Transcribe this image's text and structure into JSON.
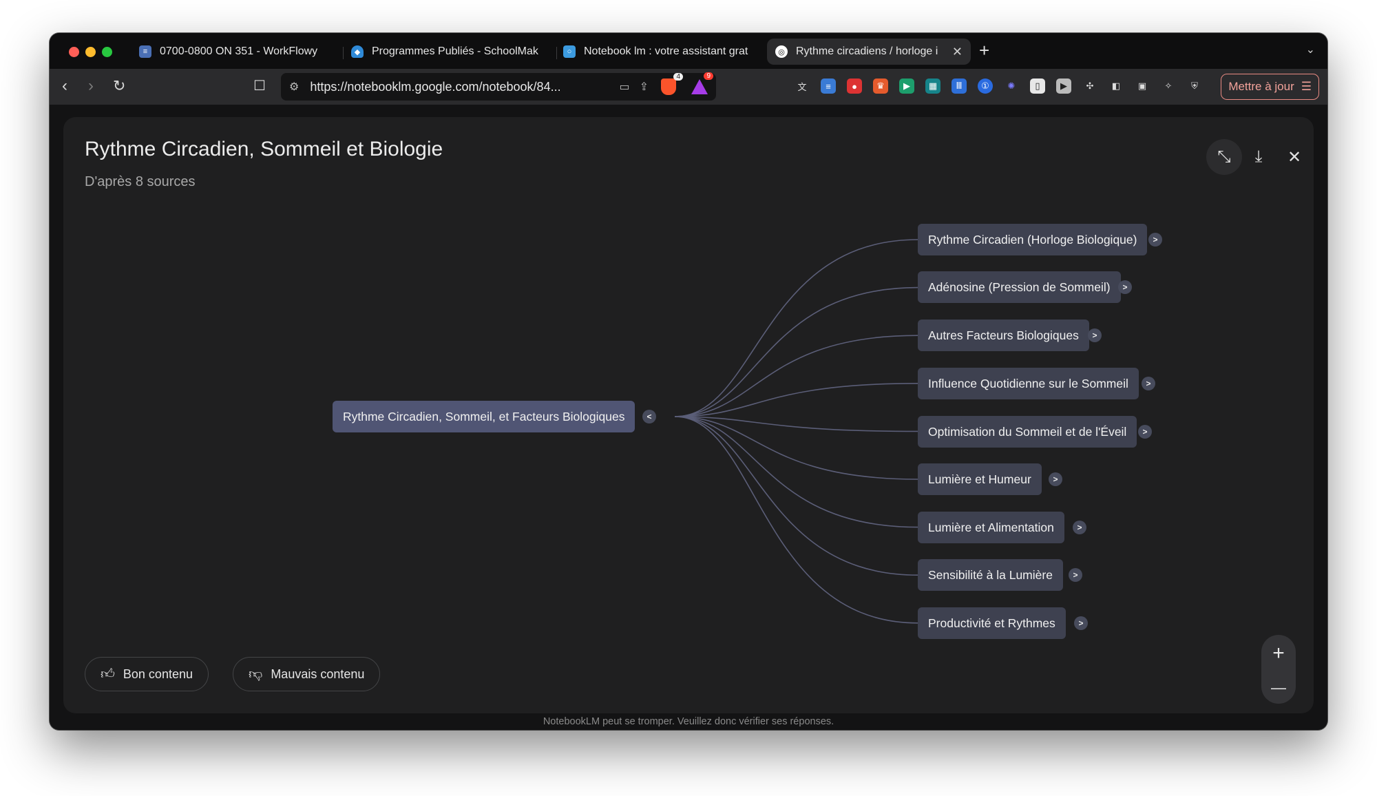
{
  "browser": {
    "tabs": [
      {
        "label": "0700-0800 ON 351 - WorkFlowy",
        "favicon": "workflowy-icon",
        "color": "#4a6fb5"
      },
      {
        "label": "Programmes Publiés - SchoolMak",
        "favicon": "schoolmaker-icon",
        "color": "#2f8ad8"
      },
      {
        "label": "Notebook lm : votre assistant grat",
        "favicon": "notebook-icon",
        "color": "#3c9be0"
      },
      {
        "label": "Rythme circadiens / horloge i",
        "favicon": "notebooklm-icon",
        "color": "#ffffff",
        "active": true
      }
    ],
    "tab_close_glyph": "✕",
    "new_tab_glyph": "+",
    "tab_menu_glyph": "⌄",
    "url": "https://notebooklm.google.com/notebook/84...",
    "shields_badge": "4",
    "rewards_badge": "9",
    "update_button": "Mettre à jour"
  },
  "panel": {
    "title": "Rythme Circadien, Sommeil et Biologie",
    "subtitle": "D'après 8 sources"
  },
  "mindmap": {
    "root": {
      "label": "Rythme Circadien, Sommeil, et Facteurs Biologiques",
      "toggle": "<"
    },
    "children": [
      {
        "label": "Rythme Circadien (Horloge Biologique)",
        "toggle": ">"
      },
      {
        "label": "Adénosine (Pression de Sommeil)",
        "toggle": ">"
      },
      {
        "label": "Autres Facteurs Biologiques",
        "toggle": ">"
      },
      {
        "label": "Influence Quotidienne sur le Sommeil",
        "toggle": ">"
      },
      {
        "label": "Optimisation du Sommeil et de l'Éveil",
        "toggle": ">"
      },
      {
        "label": "Lumière et Humeur",
        "toggle": ">"
      },
      {
        "label": "Lumière et Alimentation",
        "toggle": ">"
      },
      {
        "label": "Sensibilité à la Lumière",
        "toggle": ">"
      },
      {
        "label": "Productivité et Rythmes",
        "toggle": ">"
      }
    ]
  },
  "feedback": {
    "good": "Bon contenu",
    "bad": "Mauvais contenu"
  },
  "zoom": {
    "in": "+",
    "out": "—"
  },
  "disclaimer": "NotebookLM peut se tromper. Veuillez donc vérifier ses réponses."
}
